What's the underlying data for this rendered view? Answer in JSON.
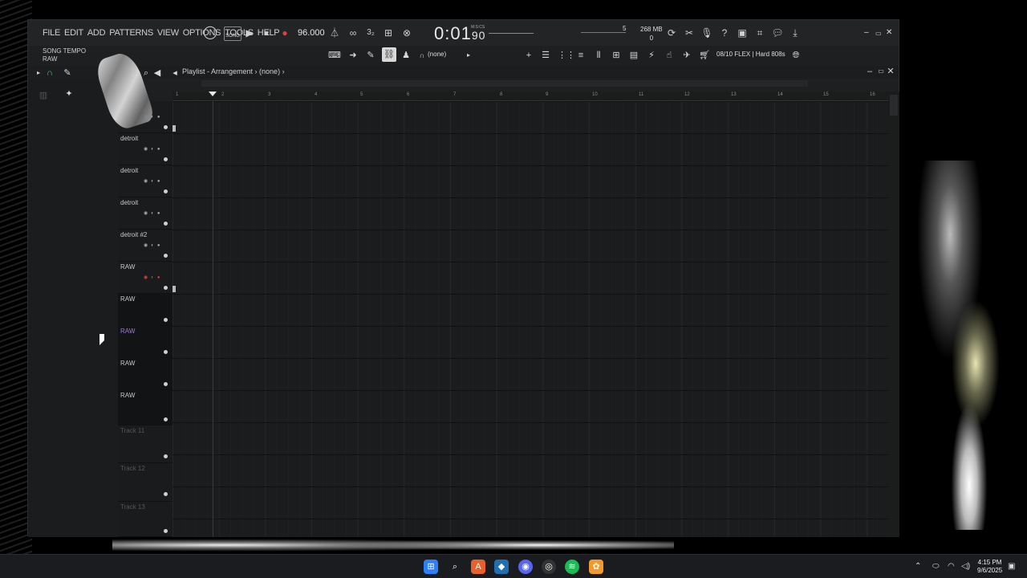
{
  "menu": [
    "FILE",
    "EDIT",
    "ADD",
    "PATTERNS",
    "VIEW",
    "OPTIONS",
    "TOOLS",
    "HELP"
  ],
  "transport": {
    "mode_label": "SONG",
    "tempo": "96.000",
    "time": "0:01",
    "time_frac": "90",
    "time_unit": "M:S:CS",
    "cpu_value": "5",
    "memory": "268 MB",
    "memory_sub": "0"
  },
  "hint": {
    "line1": "SONG TEMPO",
    "line2": "RAW"
  },
  "toolbar2": {
    "pattern": "(none)",
    "flex": "08/10 FLEX | Hard 808s"
  },
  "playlist": {
    "title": "Playlist - Arrangement",
    "pattern_sel": "(none)"
  },
  "ruler": [
    "1",
    "2",
    "3",
    "4",
    "5",
    "6",
    "7",
    "8",
    "9",
    "10",
    "11",
    "12",
    "13",
    "14",
    "15",
    "16"
  ],
  "tracks": [
    {
      "name": ""
    },
    {
      "name": "detroit"
    },
    {
      "name": "detroit"
    },
    {
      "name": "detroit"
    },
    {
      "name": "detroit #2"
    },
    {
      "name": "RAW"
    },
    {
      "name": "RAW"
    },
    {
      "name": "RAW"
    },
    {
      "name": "RAW"
    },
    {
      "name": "RAW"
    },
    {
      "name": "Track 11"
    },
    {
      "name": "Track 12"
    },
    {
      "name": "Track 13"
    }
  ],
  "taskbar": {
    "time": "4:15 PM",
    "date": "9/6/2025"
  },
  "colors": {
    "accent_green": "#47c96a",
    "record_red": "#e0403a",
    "purple_track": "#9c7ed8"
  }
}
